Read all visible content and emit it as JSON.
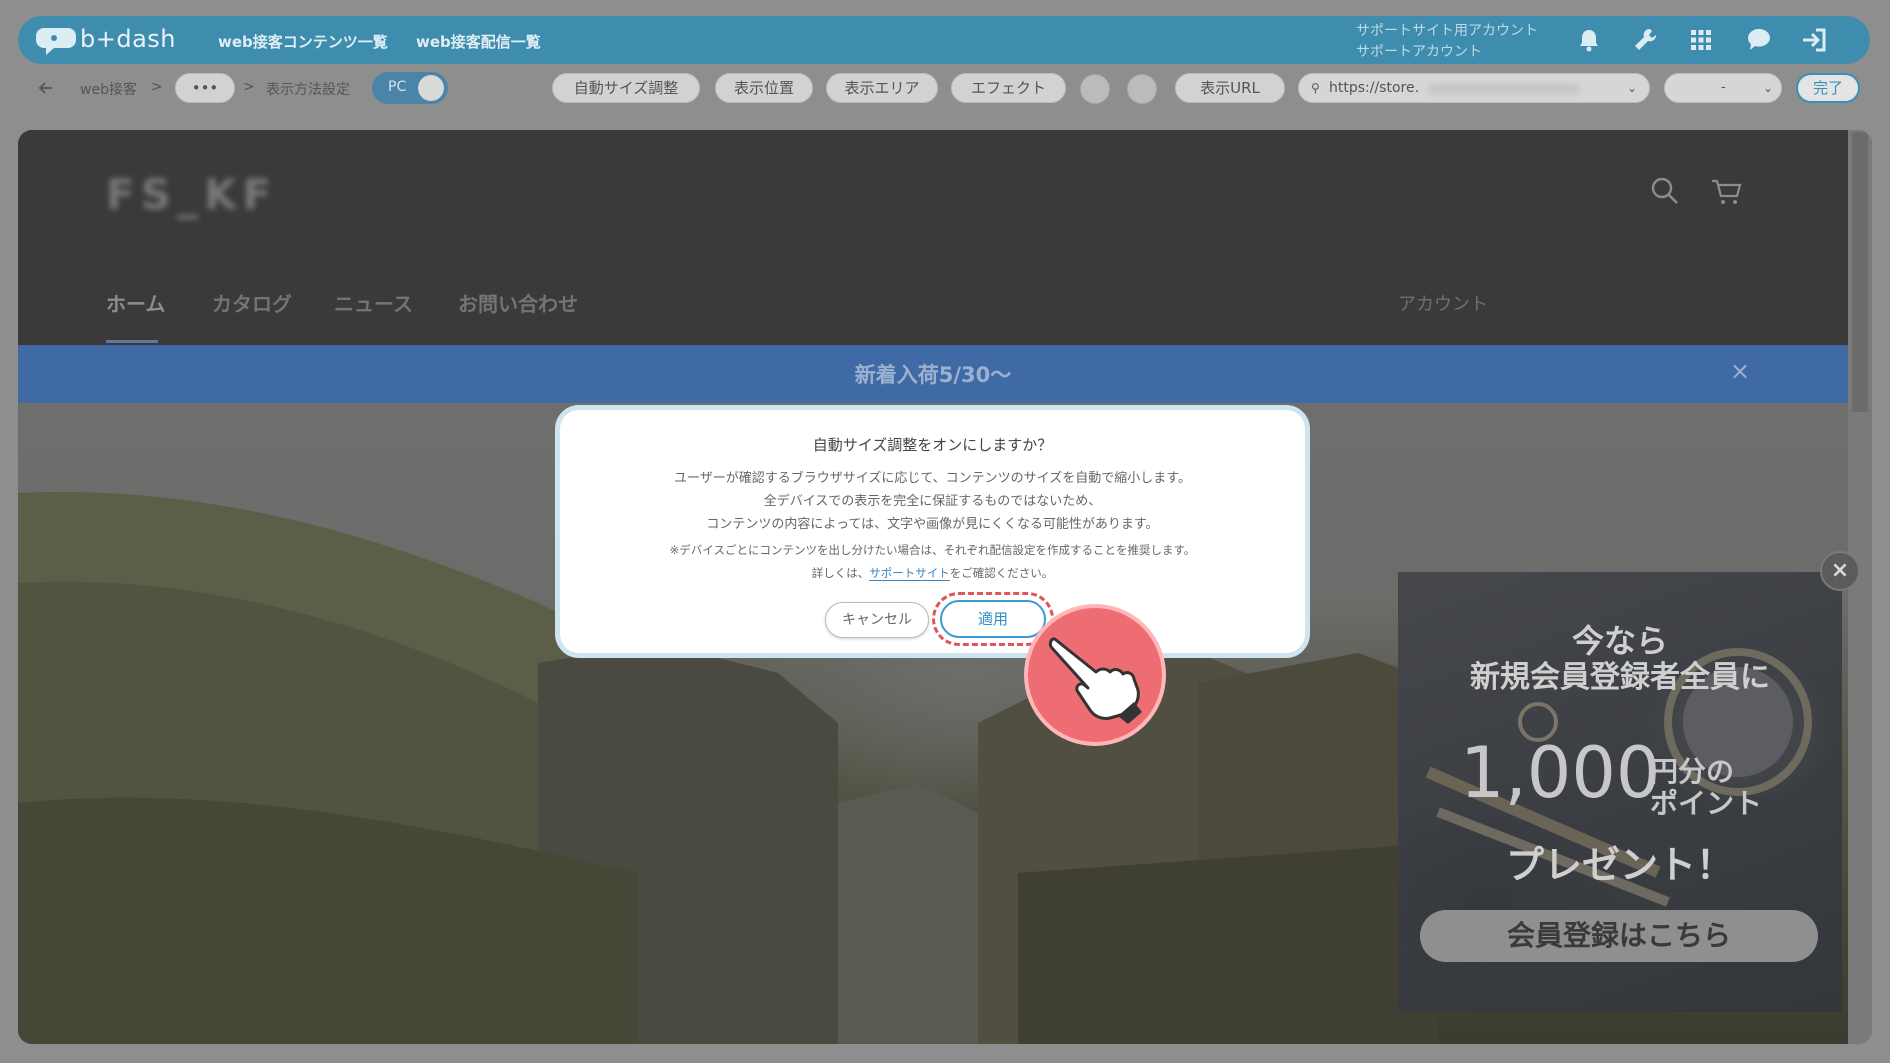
{
  "app": {
    "logo_text": "b+dash",
    "nav": [
      "web接客コンテンツ一覧",
      "web接客配信一覧"
    ],
    "account_line1": "サポートサイト用アカウント",
    "account_line2": "サポートアカウント",
    "icons": [
      "bell-icon",
      "wrench-icon",
      "grid-icon",
      "chat-icon",
      "logout-icon"
    ]
  },
  "toolbar": {
    "breadcrumb_root": "web接客",
    "breadcrumb_more": "•••",
    "breadcrumb_current": "表示方法設定",
    "device_toggle": "PC",
    "buttons": [
      "自動サイズ調整",
      "表示位置",
      "表示エリア",
      "エフェクト"
    ],
    "url_label": "表示URL",
    "url_value": "https://store.",
    "select_value": "-",
    "done": "完了"
  },
  "site": {
    "logo": "FS_KF",
    "menu": [
      "ホーム",
      "カタログ",
      "ニュース",
      "お問い合わせ"
    ],
    "account": "アカウント",
    "announcement": "新着入荷5/30〜",
    "announcement_close": "×"
  },
  "modal": {
    "title": "自動サイズ調整をオンにしますか？",
    "line1": "ユーザーが確認するブラウザサイズに応じて、コンテンツのサイズを自動で縮小します。",
    "line2": "全デバイスでの表示を完全に保証するものではないため、",
    "line3": "コンテンツの内容によっては、文字や画像が見にくくなる可能性があります。",
    "note1": "※デバイスごとにコンテンツを出し分けたい場合は、それぞれ配信設定を作成することを推奨します。",
    "note2_prefix": "詳しくは、",
    "note2_link": "サポートサイト",
    "note2_suffix": "をご確認ください。",
    "cancel": "キャンセル",
    "apply": "適用"
  },
  "ad": {
    "line1": "今なら",
    "line2": "新規会員登録者全員に",
    "amount": "1,000",
    "unit_top": "円分の",
    "unit_bottom": "ポイント",
    "line4": "プレゼント！",
    "button": "会員登録はこちら",
    "close": "×"
  },
  "colors": {
    "app_header": "#3f8dae",
    "announcement": "#3f6aa5",
    "apply_button": "#3a9ad4",
    "highlight": "#e0545a",
    "pointer_badge": "#ee6d72"
  }
}
